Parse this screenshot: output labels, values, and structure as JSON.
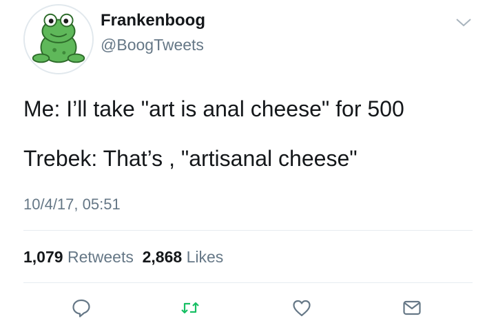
{
  "author": {
    "display_name": "Frankenboog",
    "handle": "@BoogTweets",
    "avatar_icon": "frog-avatar-icon"
  },
  "tweet": {
    "lines": [
      "Me: I’ll take \"art is anal cheese\" for 500",
      "Trebek: That’s , \"artisanal cheese\""
    ],
    "timestamp": "10/4/17, 05:51"
  },
  "stats": {
    "retweets_count": "1,079",
    "retweets_label": "Retweets",
    "likes_count": "2,868",
    "likes_label": "Likes"
  },
  "actions": [
    {
      "icon": "reply-icon"
    },
    {
      "icon": "retweet-icon"
    },
    {
      "icon": "like-icon"
    },
    {
      "icon": "direct-message-icon"
    }
  ],
  "colors": {
    "text": "#14171a",
    "secondary": "#657786",
    "divider": "#e6ecf0",
    "retweet_green": "#17bf63",
    "frog_green": "#5fb85a"
  }
}
